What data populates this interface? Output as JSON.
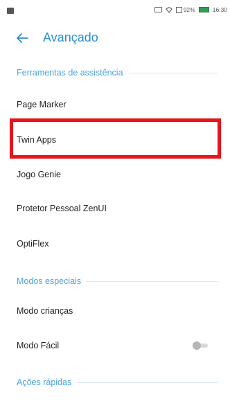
{
  "status_bar": {
    "battery_percent": "92%",
    "time": "16:30",
    "colors": {
      "battery": "#30a050",
      "icons": "#555555"
    }
  },
  "app_bar": {
    "title": "Avançado",
    "back_icon": "arrow-left-icon",
    "color": "#2a8fd3"
  },
  "sections": [
    {
      "header": "Ferramentas de assistência",
      "items": [
        {
          "label": "Page Marker"
        },
        {
          "label": "Twin Apps",
          "highlighted": true
        },
        {
          "label": "Jogo Genie"
        },
        {
          "label": "Protetor Pessoal ZenUI"
        },
        {
          "label": "OptiFlex"
        }
      ]
    },
    {
      "header": "Modos especiais",
      "items": [
        {
          "label": "Modo crianças"
        },
        {
          "label": "Modo Fácil",
          "toggle": false
        }
      ]
    },
    {
      "header": "Ações rápidas",
      "items": []
    }
  ],
  "colors": {
    "section_header": "#4aa3df",
    "highlight_border": "#e8141b",
    "toggle_off": "#b6b6b6"
  }
}
